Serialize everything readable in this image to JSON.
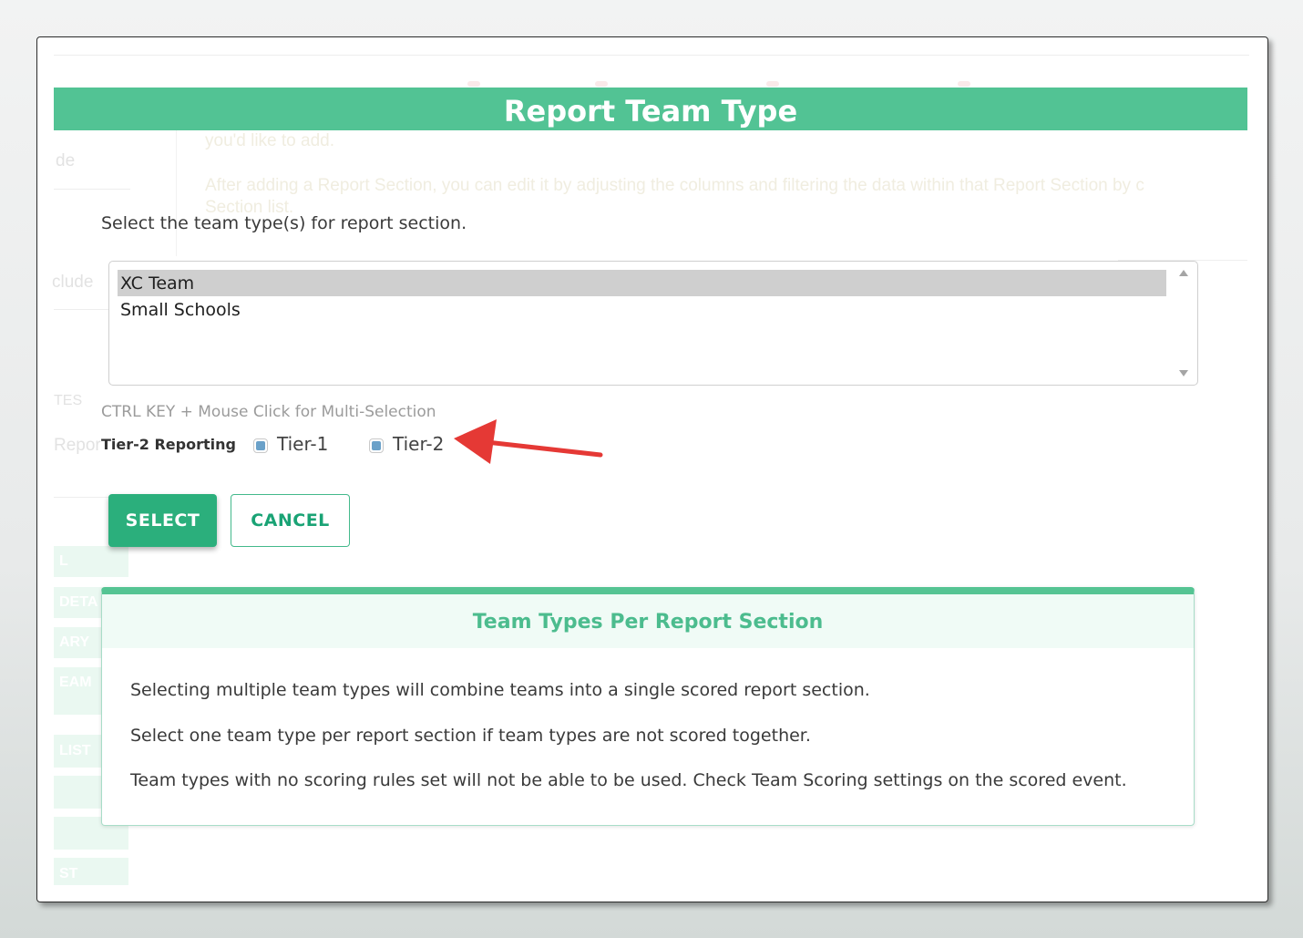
{
  "modal": {
    "title": "Report Team Type",
    "instruction": "Select the team type(s) for report section.",
    "options": [
      "XC Team",
      "Small Schools"
    ],
    "selected_option": "XC Team",
    "hint": "CTRL KEY + Mouse Click for Multi-Selection",
    "tier_label": "Tier-2 Reporting",
    "checkboxes": [
      {
        "label": "Tier-1",
        "checked": true
      },
      {
        "label": "Tier-2",
        "checked": true
      }
    ],
    "select_label": "SELECT",
    "cancel_label": "CANCEL"
  },
  "info": {
    "title": "Team Types Per Report Section",
    "lines": [
      "Selecting multiple team types will combine teams into a single scored report section.",
      "Select one team type per report section if team types are not scored together.",
      "Team types with no scoring rules set will not be able to be used. Check Team Scoring settings on the scored event."
    ]
  },
  "background_page": {
    "side_labels": [
      "de",
      "clude",
      "TES",
      "Repor"
    ],
    "side_buttons": [
      "L",
      "DETA",
      "ARY",
      "EAM",
      "LIST",
      "",
      "",
      "ST"
    ],
    "body_lines": [
      "you'd like to add.",
      "After adding a Report Section, you can edit it by adjusting the columns and filtering the data within that Report Section by c",
      "Section list."
    ]
  },
  "colors": {
    "header_green": "#52c394",
    "select_button": "#2baf7c",
    "cancel_text": "#1aa375",
    "annotation_arrow": "#e53935",
    "checkbox_fill": "#6aa1c9"
  },
  "icons": {
    "annotation": "red-arrow-icon"
  }
}
